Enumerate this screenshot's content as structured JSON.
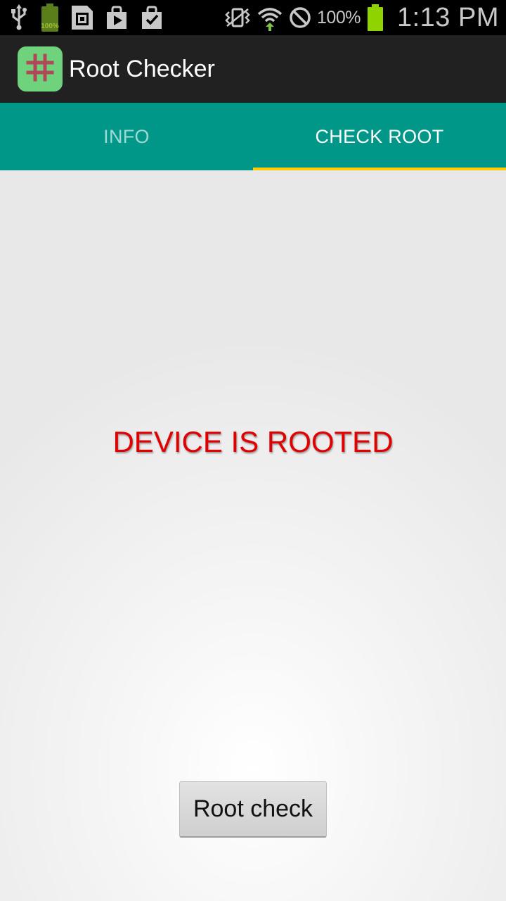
{
  "status_bar": {
    "left_icons": [
      "usb-icon",
      "battery-full-icon",
      "sd-card-icon",
      "play-store-icon",
      "task-done-icon"
    ],
    "small_battery_label": "100%",
    "right_icons": [
      "vibrate-icon",
      "wifi-icon",
      "blocked-icon",
      "battery-icon"
    ],
    "battery_percent": "100%",
    "time": "1:13 PM"
  },
  "action_bar": {
    "app_icon": "hash-icon",
    "title": "Root Checker"
  },
  "tabs": [
    {
      "label": "INFO",
      "selected": false
    },
    {
      "label": "CHECK ROOT",
      "selected": true
    }
  ],
  "content": {
    "result_text": "DEVICE IS ROOTED",
    "result_color": "#e00000",
    "button_label": "Root check"
  },
  "colors": {
    "tab_bar": "#009688",
    "tab_indicator": "#ffcc00",
    "action_bar": "#212121",
    "app_icon_bg": "#6fd27c"
  }
}
